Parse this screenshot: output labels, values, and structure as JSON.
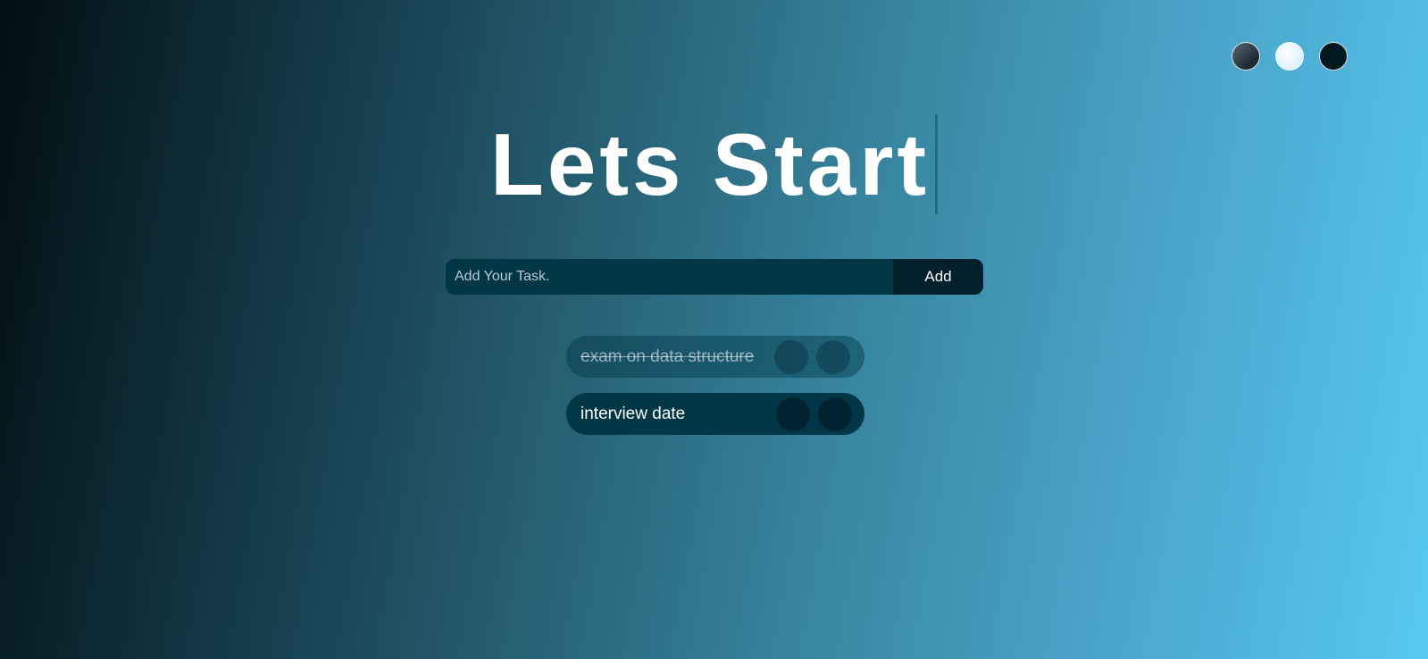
{
  "header": {
    "title": "Lets Start"
  },
  "themes": [
    {
      "name": "standard",
      "color": "#3b4a55"
    },
    {
      "name": "light",
      "color": "#e6f6ff"
    },
    {
      "name": "darker",
      "color": "#021820"
    }
  ],
  "form": {
    "input_placeholder": "Add Your Task.",
    "input_value": "",
    "add_label": "Add"
  },
  "todos": [
    {
      "text": "exam on data structure",
      "completed": true
    },
    {
      "text": "interview date",
      "completed": false
    }
  ],
  "colors": {
    "accent_dark": "#003747",
    "button_dark": "#00212c",
    "text": "#ffffff"
  }
}
